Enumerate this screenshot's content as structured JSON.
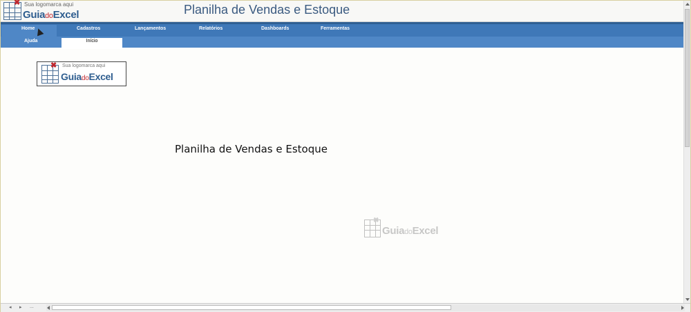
{
  "header": {
    "logo": {
      "tagline": "Sua logomarca aqui",
      "brand_part1": "Guia",
      "brand_part2": "do",
      "brand_part3": "Excel"
    },
    "title": "Planilha de Vendas e Estoque"
  },
  "ribbon": {
    "tabs": [
      {
        "label": "Home"
      },
      {
        "label": "Cadastros"
      },
      {
        "label": "Lançamentos"
      },
      {
        "label": "Relatórios"
      },
      {
        "label": "Dashboards"
      },
      {
        "label": "Ferramentas"
      }
    ],
    "subtabs": [
      {
        "label": "Ajuda"
      },
      {
        "label": "Início"
      }
    ]
  },
  "main": {
    "logo": {
      "tagline": "Sua logomarca aqui",
      "brand_part1": "Guia",
      "brand_part2": "do",
      "brand_part3": "Excel"
    },
    "title": "Planilha de Vendas e Estoque",
    "watermark": {
      "brand_part1": "Guia",
      "brand_part2": "do",
      "brand_part3": "Excel"
    }
  },
  "statusbar": {
    "nav_prev": "◂",
    "nav_next": "▸",
    "nav_more": "..."
  },
  "colors": {
    "ribbon": "#4f87c6",
    "ribbon_tabs": "#3f78b8",
    "brand_blue": "#2e5d8f",
    "brand_red": "#c0282f"
  }
}
